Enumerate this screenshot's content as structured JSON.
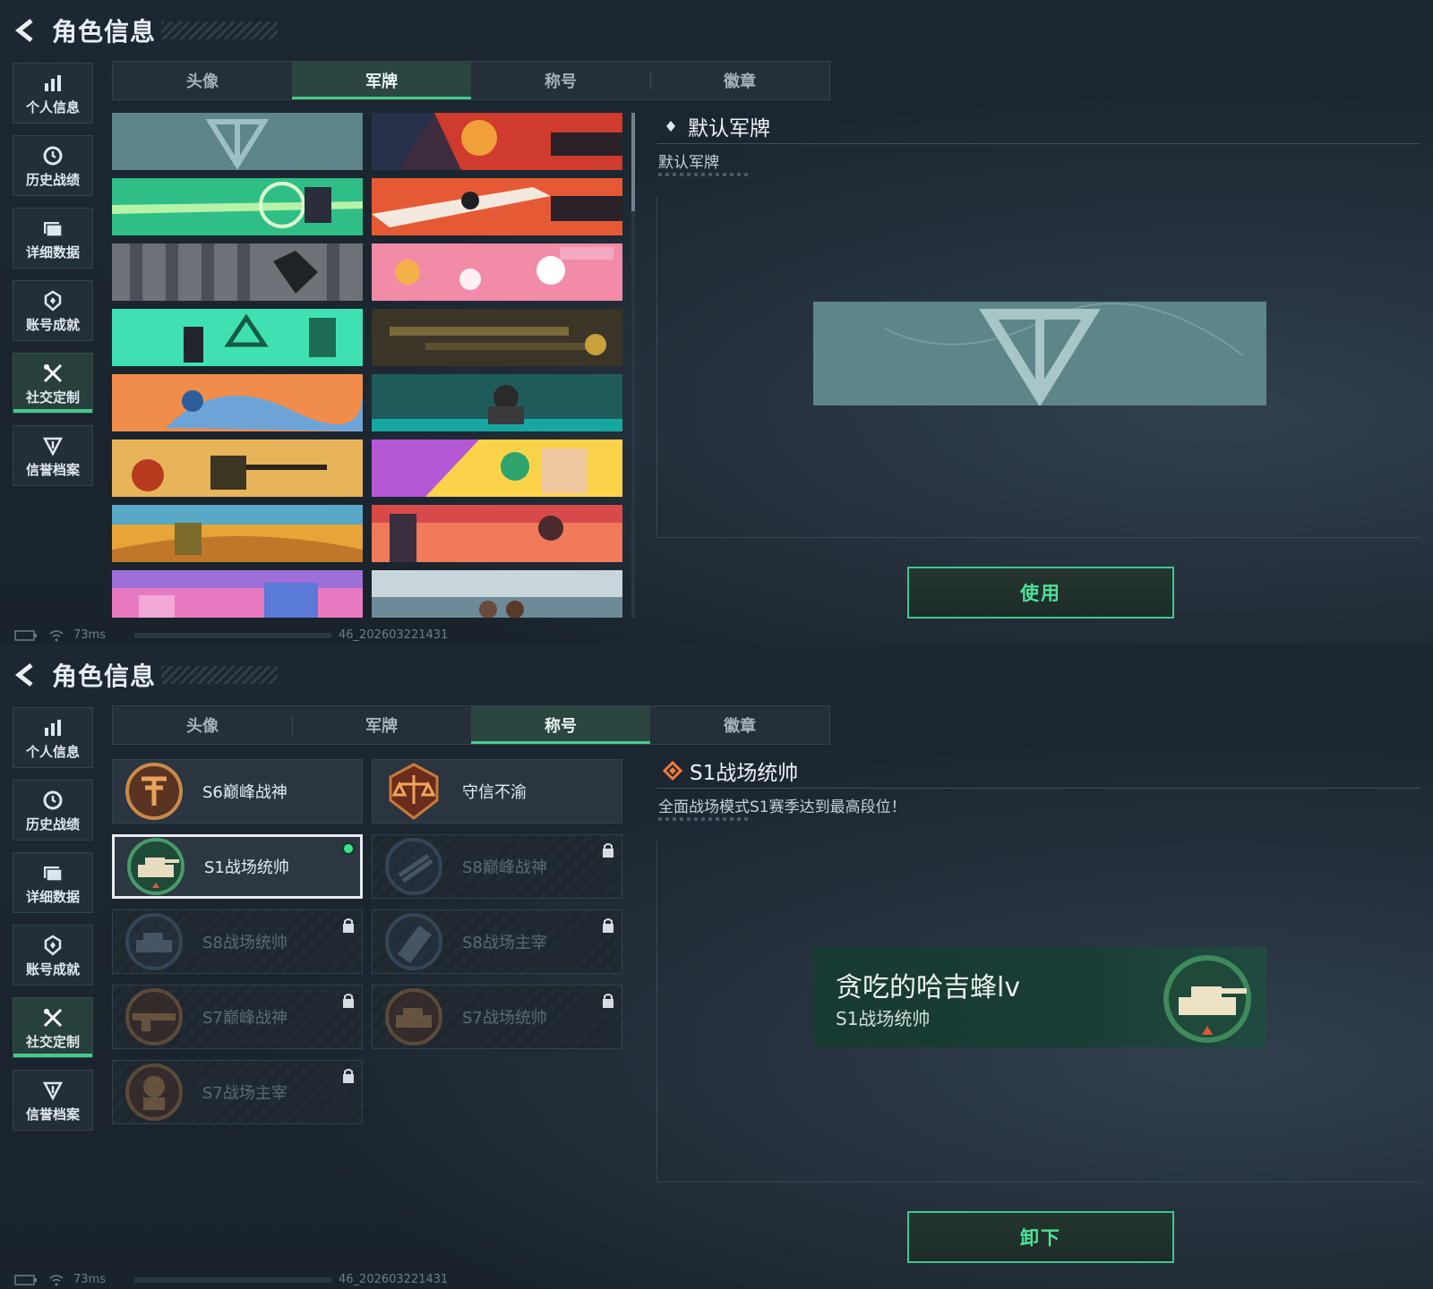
{
  "header": {
    "title": "角色信息"
  },
  "sidebar": {
    "items": [
      {
        "label": "个人信息",
        "icon": "bar-chart-icon"
      },
      {
        "label": "历史战绩",
        "icon": "history-icon"
      },
      {
        "label": "详细数据",
        "icon": "folder-icon"
      },
      {
        "label": "账号成就",
        "icon": "achievement-icon"
      },
      {
        "label": "社交定制",
        "icon": "tools-icon",
        "active": true
      },
      {
        "label": "信誉档案",
        "icon": "shield-icon"
      }
    ]
  },
  "tabs": [
    "头像",
    "军牌",
    "称号",
    "徽章"
  ],
  "panel1": {
    "active_tab": "军牌",
    "detail_title": "默认军牌",
    "detail_desc": "默认军牌",
    "action_label": "使用"
  },
  "panel2": {
    "active_tab": "称号",
    "detail_title": "S1战场统帅",
    "detail_desc": "全面战场模式S1赛季达到最高段位！",
    "player_name": "贪吃的哈吉蜂lv",
    "card_title": "S1战场统帅",
    "action_label": "卸下",
    "titles": [
      {
        "name": "S6巅峰战神",
        "locked": false
      },
      {
        "name": "守信不渝",
        "locked": false
      },
      {
        "name": "S1战场统帅",
        "locked": false,
        "selected": true,
        "equipped": true
      },
      {
        "name": "S8巅峰战神",
        "locked": true
      },
      {
        "name": "S8战场统帅",
        "locked": true
      },
      {
        "name": "S8战场主宰",
        "locked": true
      },
      {
        "name": "S7巅峰战神",
        "locked": true
      },
      {
        "name": "S7战场统帅",
        "locked": true
      },
      {
        "name": "S7战场主宰",
        "locked": true
      }
    ]
  },
  "status": {
    "ping": "73ms",
    "build": "46_202603221431"
  },
  "colors": {
    "accent": "#46c98b",
    "button_text": "#4fe39a",
    "background": "#1c2630"
  }
}
